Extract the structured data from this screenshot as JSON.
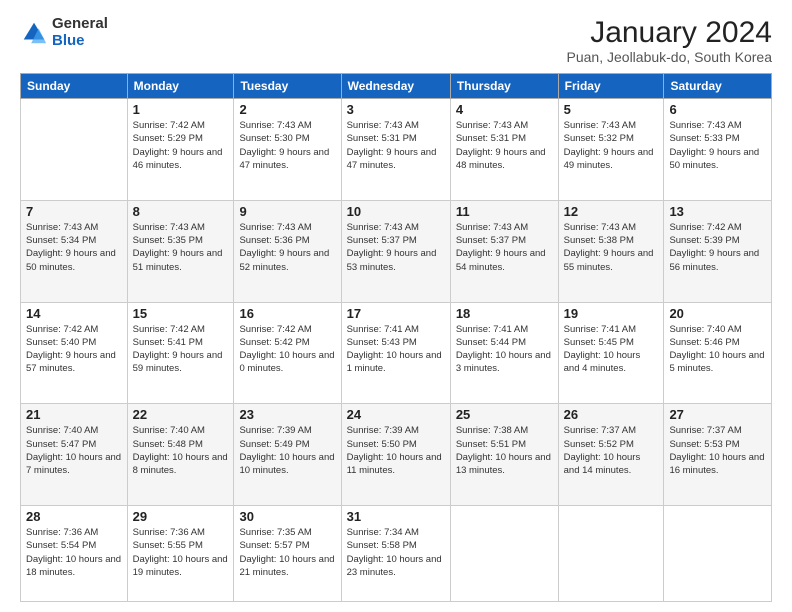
{
  "logo": {
    "general": "General",
    "blue": "Blue"
  },
  "header": {
    "title": "January 2024",
    "subtitle": "Puan, Jeollabuk-do, South Korea"
  },
  "weekdays": [
    "Sunday",
    "Monday",
    "Tuesday",
    "Wednesday",
    "Thursday",
    "Friday",
    "Saturday"
  ],
  "weeks": [
    [
      {
        "day": "",
        "info": ""
      },
      {
        "day": "1",
        "info": "Sunrise: 7:42 AM\nSunset: 5:29 PM\nDaylight: 9 hours\nand 46 minutes."
      },
      {
        "day": "2",
        "info": "Sunrise: 7:43 AM\nSunset: 5:30 PM\nDaylight: 9 hours\nand 47 minutes."
      },
      {
        "day": "3",
        "info": "Sunrise: 7:43 AM\nSunset: 5:31 PM\nDaylight: 9 hours\nand 47 minutes."
      },
      {
        "day": "4",
        "info": "Sunrise: 7:43 AM\nSunset: 5:31 PM\nDaylight: 9 hours\nand 48 minutes."
      },
      {
        "day": "5",
        "info": "Sunrise: 7:43 AM\nSunset: 5:32 PM\nDaylight: 9 hours\nand 49 minutes."
      },
      {
        "day": "6",
        "info": "Sunrise: 7:43 AM\nSunset: 5:33 PM\nDaylight: 9 hours\nand 50 minutes."
      }
    ],
    [
      {
        "day": "7",
        "info": "Sunrise: 7:43 AM\nSunset: 5:34 PM\nDaylight: 9 hours\nand 50 minutes."
      },
      {
        "day": "8",
        "info": "Sunrise: 7:43 AM\nSunset: 5:35 PM\nDaylight: 9 hours\nand 51 minutes."
      },
      {
        "day": "9",
        "info": "Sunrise: 7:43 AM\nSunset: 5:36 PM\nDaylight: 9 hours\nand 52 minutes."
      },
      {
        "day": "10",
        "info": "Sunrise: 7:43 AM\nSunset: 5:37 PM\nDaylight: 9 hours\nand 53 minutes."
      },
      {
        "day": "11",
        "info": "Sunrise: 7:43 AM\nSunset: 5:37 PM\nDaylight: 9 hours\nand 54 minutes."
      },
      {
        "day": "12",
        "info": "Sunrise: 7:43 AM\nSunset: 5:38 PM\nDaylight: 9 hours\nand 55 minutes."
      },
      {
        "day": "13",
        "info": "Sunrise: 7:42 AM\nSunset: 5:39 PM\nDaylight: 9 hours\nand 56 minutes."
      }
    ],
    [
      {
        "day": "14",
        "info": "Sunrise: 7:42 AM\nSunset: 5:40 PM\nDaylight: 9 hours\nand 57 minutes."
      },
      {
        "day": "15",
        "info": "Sunrise: 7:42 AM\nSunset: 5:41 PM\nDaylight: 9 hours\nand 59 minutes."
      },
      {
        "day": "16",
        "info": "Sunrise: 7:42 AM\nSunset: 5:42 PM\nDaylight: 10 hours\nand 0 minutes."
      },
      {
        "day": "17",
        "info": "Sunrise: 7:41 AM\nSunset: 5:43 PM\nDaylight: 10 hours\nand 1 minute."
      },
      {
        "day": "18",
        "info": "Sunrise: 7:41 AM\nSunset: 5:44 PM\nDaylight: 10 hours\nand 3 minutes."
      },
      {
        "day": "19",
        "info": "Sunrise: 7:41 AM\nSunset: 5:45 PM\nDaylight: 10 hours\nand 4 minutes."
      },
      {
        "day": "20",
        "info": "Sunrise: 7:40 AM\nSunset: 5:46 PM\nDaylight: 10 hours\nand 5 minutes."
      }
    ],
    [
      {
        "day": "21",
        "info": "Sunrise: 7:40 AM\nSunset: 5:47 PM\nDaylight: 10 hours\nand 7 minutes."
      },
      {
        "day": "22",
        "info": "Sunrise: 7:40 AM\nSunset: 5:48 PM\nDaylight: 10 hours\nand 8 minutes."
      },
      {
        "day": "23",
        "info": "Sunrise: 7:39 AM\nSunset: 5:49 PM\nDaylight: 10 hours\nand 10 minutes."
      },
      {
        "day": "24",
        "info": "Sunrise: 7:39 AM\nSunset: 5:50 PM\nDaylight: 10 hours\nand 11 minutes."
      },
      {
        "day": "25",
        "info": "Sunrise: 7:38 AM\nSunset: 5:51 PM\nDaylight: 10 hours\nand 13 minutes."
      },
      {
        "day": "26",
        "info": "Sunrise: 7:37 AM\nSunset: 5:52 PM\nDaylight: 10 hours\nand 14 minutes."
      },
      {
        "day": "27",
        "info": "Sunrise: 7:37 AM\nSunset: 5:53 PM\nDaylight: 10 hours\nand 16 minutes."
      }
    ],
    [
      {
        "day": "28",
        "info": "Sunrise: 7:36 AM\nSunset: 5:54 PM\nDaylight: 10 hours\nand 18 minutes."
      },
      {
        "day": "29",
        "info": "Sunrise: 7:36 AM\nSunset: 5:55 PM\nDaylight: 10 hours\nand 19 minutes."
      },
      {
        "day": "30",
        "info": "Sunrise: 7:35 AM\nSunset: 5:57 PM\nDaylight: 10 hours\nand 21 minutes."
      },
      {
        "day": "31",
        "info": "Sunrise: 7:34 AM\nSunset: 5:58 PM\nDaylight: 10 hours\nand 23 minutes."
      },
      {
        "day": "",
        "info": ""
      },
      {
        "day": "",
        "info": ""
      },
      {
        "day": "",
        "info": ""
      }
    ]
  ]
}
